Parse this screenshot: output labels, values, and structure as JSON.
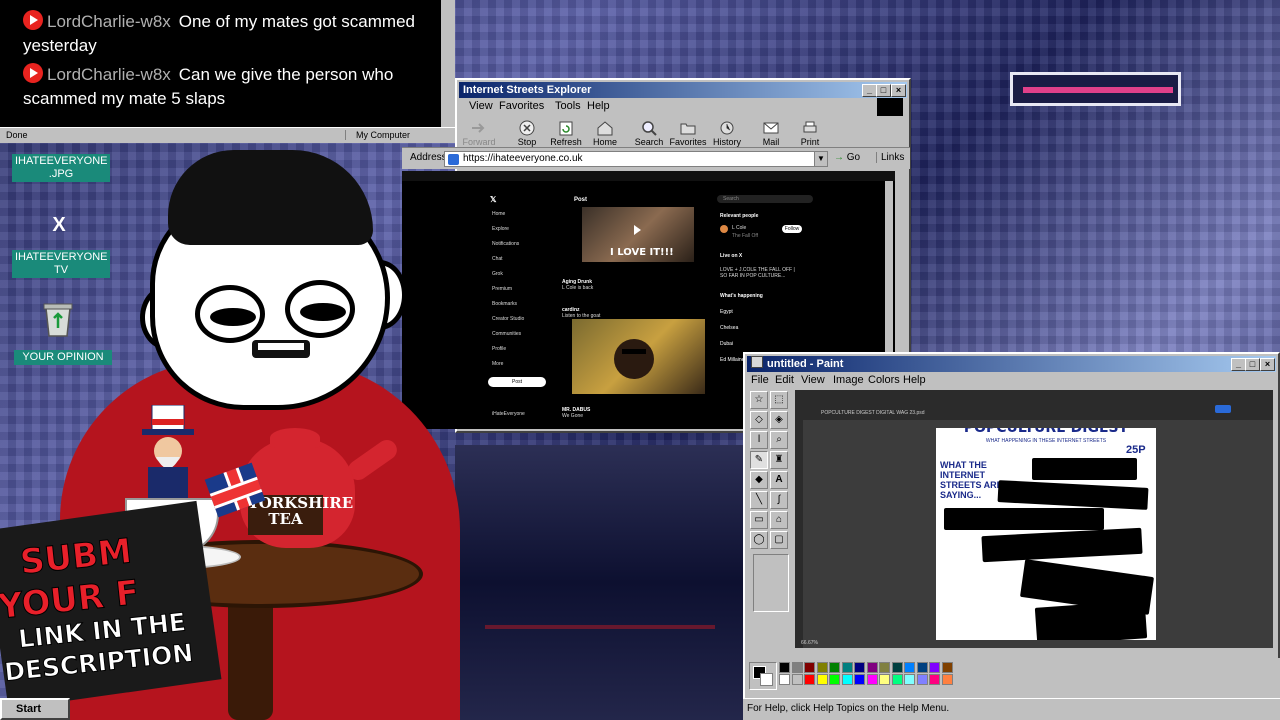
{
  "chat": {
    "top_partial": "                    y  y   g   ,  p",
    "messages": [
      {
        "user": "LordCharlie-w8x",
        "text": "One of my mates got scammed yesterday"
      },
      {
        "user": "LordCharlie-w8x",
        "text": "Can we give the person who scammed my mate 5 slaps"
      }
    ],
    "status_done": "Done",
    "status_zone": "My Computer"
  },
  "desktop_icons": [
    {
      "label": "IHATEEVERYONE .JPG"
    },
    {
      "label": "IHATEEVERYONE TV"
    },
    {
      "label": "YOUR OPINION"
    }
  ],
  "explorer": {
    "title": "Internet Streets Explorer",
    "menu": [
      "View",
      "Favorites",
      "Tools",
      "Help"
    ],
    "toolbar": [
      "Forward",
      "Stop",
      "Refresh",
      "Home",
      "Search",
      "Favorites",
      "History",
      "Mail",
      "Print"
    ],
    "address_label": "Address",
    "url": "https://ihateeveryone.co.uk",
    "go_label": "Go",
    "links_label": "Links"
  },
  "x_page": {
    "header": "Post",
    "nav": [
      "Home",
      "Explore",
      "Notifications",
      "Chat",
      "Grok",
      "Premium",
      "Bookmarks",
      "Creator Studio",
      "Communities",
      "Profile",
      "More"
    ],
    "post_button": "Post",
    "video_caption": "I LOVE IT!!!",
    "tweet1_user": "Aging Drunk",
    "tweet1_text": "L Cole is back",
    "tweet2_user": "cardinz",
    "tweet2_text": "Listen to the goat",
    "tweet3_user": "MR. DABUS",
    "tweet3_text": "We Gone",
    "side_relevant": "Relevant people",
    "side_person": "L Cole",
    "side_handle": "The Fall Off",
    "follow": "Follow",
    "live_on_x": "Live on X",
    "live_text": "LOVE + J.COLE THE FALL OFF | SO FAR IN POP CULTURE...",
    "whats_happening": "What's happening",
    "trends": [
      "Egypt",
      "Chelsea",
      "Dubai",
      "Ed Millaine"
    ],
    "account_name": "iHateEveryone",
    "search_placeholder": "Search"
  },
  "paint": {
    "title": "untitled - Paint",
    "menu": [
      "File",
      "Edit",
      "View",
      "Image",
      "Colors",
      "Help"
    ],
    "status": "For Help, click Help Topics on the Help Menu.",
    "poster_title": "POPCULTURE DIGEST",
    "poster_subtitle": "WHAT HAPPENING IN THESE INTERNET STREETS",
    "poster_price": "25P",
    "poster_headline": "WHAT THE INTERNET STREETS ARE SAYING...",
    "tab_label": "POPCULTURE DIGEST DIGITAL WAG 23.psd",
    "zoom": "66.67%",
    "palette": [
      "#000000",
      "#808080",
      "#800000",
      "#808000",
      "#008000",
      "#008080",
      "#000080",
      "#800080",
      "#808040",
      "#004040",
      "#0080ff",
      "#004080",
      "#8000ff",
      "#804000",
      "#ffffff",
      "#c0c0c0",
      "#ff0000",
      "#ffff00",
      "#00ff00",
      "#00ffff",
      "#0000ff",
      "#ff00ff",
      "#ffff80",
      "#00ff80",
      "#80ffff",
      "#8080ff",
      "#ff0080",
      "#ff8040"
    ]
  },
  "overlay": {
    "sub_line1": "SUBM",
    "sub_line2": "YOUR F",
    "sub_line3": "LINK IN THE",
    "sub_line4": "DESCRIPTION",
    "teapot_brand": "YORKSHIRE TEA",
    "taskbar_start": "Start"
  }
}
